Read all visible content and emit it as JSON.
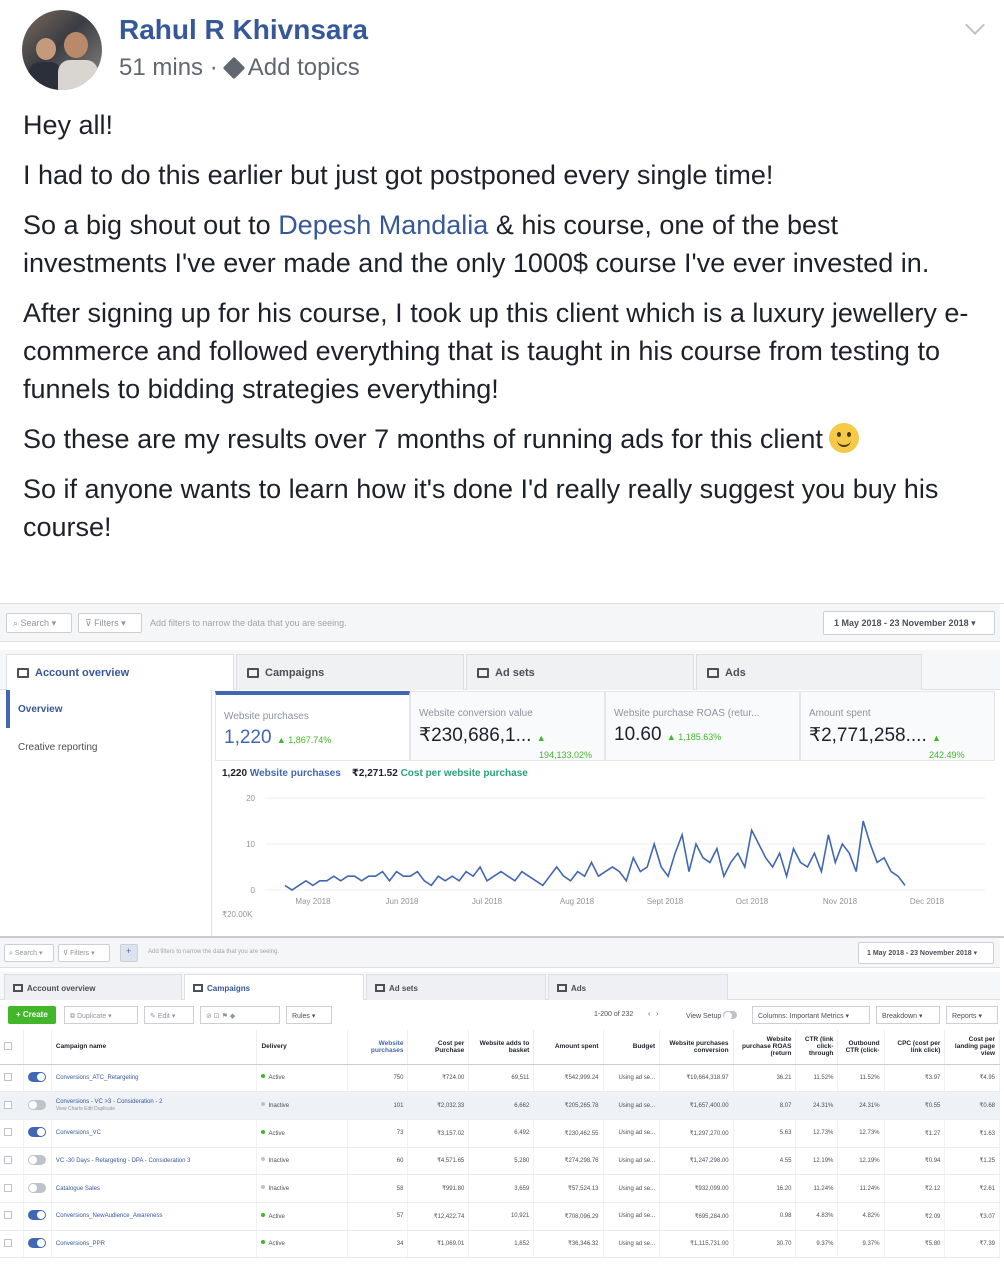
{
  "post": {
    "author": "Rahul R Khivnsara",
    "time": "51 mins",
    "separator": "·",
    "add_topics": "Add topics",
    "p1": "Hey all!",
    "p2": "I had to do this earlier but just got postponed every single time!",
    "p3_before": "So a big shout out to ",
    "p3_mention": "Depesh Mandalia",
    "p3_after": " & his course, one of the best investments I've ever made and the only 1000$ course I've ever invested in.",
    "p4": "After signing up for his course, I took up this client which is a luxury jewellery e-commerce and followed everything that is taught in his course from testing to funnels to bidding strategies everything!",
    "p5": "So these are my results over 7 months of running ads for this client",
    "p6": "So if anyone wants to learn how it's done I'd really really suggest you buy his course!"
  },
  "shot1": {
    "search": "Search",
    "filters": "Filters",
    "hint": "Add filters to narrow the data that you are seeing.",
    "date": "1 May 2018 - 23 November 2018",
    "tabs": [
      "Account overview",
      "Campaigns",
      "Ad sets",
      "Ads"
    ],
    "nav": [
      "Overview",
      "Creative reporting"
    ],
    "metrics": [
      {
        "label": "Website purchases",
        "value": "1,220",
        "delta": "1,867.74%"
      },
      {
        "label": "Website conversion value",
        "value": "₹230,686,1...",
        "delta": "194,133.02%"
      },
      {
        "label": "Website purchase ROAS (retur...",
        "value": "10.60",
        "delta": "1,185.63%"
      },
      {
        "label": "Amount spent",
        "value": "₹2,771,258....",
        "delta": "242.49%"
      }
    ],
    "summary_count": "1,220",
    "summary_label": "Website purchases",
    "summary_cost": "₹2,271.52",
    "summary_cost_label": "Cost per website purchase",
    "bottom_axis_label": "₹20.00K"
  },
  "chart_data": {
    "type": "line",
    "y_ticks": [
      "20",
      "10",
      "0"
    ],
    "ylim": [
      0,
      20
    ],
    "x_labels": [
      "May 2018",
      "Jun 2018",
      "Jul 2018",
      "Aug 2018",
      "Sept 2018",
      "Oct 2018",
      "Nov 2018",
      "Dec 2018"
    ],
    "series": [
      {
        "values": [
          1,
          0,
          1,
          2,
          1,
          2,
          2,
          3,
          2,
          3,
          3,
          2,
          3,
          3,
          4,
          2,
          4,
          3,
          3,
          4,
          2,
          1,
          3,
          2,
          3,
          2,
          4,
          3,
          5,
          2,
          3,
          4,
          3,
          2,
          4,
          3,
          2,
          1,
          3,
          5,
          3,
          2,
          4,
          3,
          6,
          3,
          4,
          5,
          4,
          2,
          7,
          4,
          5,
          10,
          5,
          3,
          8,
          12,
          4,
          10,
          7,
          6,
          9,
          3,
          6,
          8,
          5,
          13,
          10,
          7,
          5,
          8,
          3,
          9,
          6,
          5,
          8,
          4,
          12,
          6,
          10,
          8,
          4,
          15,
          10,
          6,
          7,
          4,
          3,
          1
        ]
      }
    ]
  },
  "shot2": {
    "search": "Search",
    "filters": "Filters",
    "hint": "Add filters to narrow the data that you are seeing.",
    "date": "1 May 2018 - 23 November 2018",
    "tabs": [
      "Account overview",
      "Campaigns",
      "Ad sets",
      "Ads"
    ],
    "create": "+ Create",
    "duplicate": "Duplicate",
    "edit": "Edit",
    "rules": "Rules",
    "pager": "1-200 of 232",
    "view_setup": "View Setup",
    "columns": "Columns: Important Metrics",
    "breakdown": "Breakdown",
    "reports": "Reports",
    "headers": [
      "Campaign name",
      "Delivery",
      "Website purchases",
      "Cost per Purchase",
      "Website adds to basket",
      "Amount spent",
      "Budget",
      "Website purchases conversion",
      "Website purchase ROAS (return",
      "CTR (link click-through",
      "Outbound CTR (click-",
      "CPC (cost per link click)",
      "Cost per landing page view"
    ],
    "rows": [
      {
        "name": "Conversions_ATC_Retargeting",
        "sub": "",
        "on": true,
        "delivery": "Active",
        "purchases": "750",
        "cpp": "₹724.00",
        "atb": "69,511",
        "spent": "₹542,999.24",
        "budget": "Using ad se...",
        "conv": "₹19,664,318.97",
        "roas": "36.21",
        "ctr": "11.52%",
        "octr": "11.52%",
        "cpc": "₹3.97",
        "cplp": "₹4.95"
      },
      {
        "name": "Conversions - VC >3 - Consideration - 2",
        "sub": "View Charts  Edit  Duplicate",
        "on": false,
        "delivery": "Inactive",
        "purchases": "101",
        "cpp": "₹2,032.33",
        "atb": "6,662",
        "spent": "₹205,265.78",
        "budget": "Using ad se...",
        "conv": "₹1,657,400.00",
        "roas": "8.07",
        "ctr": "24.31%",
        "octr": "24.31%",
        "cpc": "₹0.55",
        "cplp": "₹0.68"
      },
      {
        "name": "Conversions_VC",
        "sub": "",
        "on": true,
        "delivery": "Active",
        "purchases": "73",
        "cpp": "₹3,157.02",
        "atb": "6,492",
        "spent": "₹230,462.55",
        "budget": "Using ad se...",
        "conv": "₹1,297,270.00",
        "roas": "5.63",
        "ctr": "12.73%",
        "octr": "12.73%",
        "cpc": "₹1.27",
        "cplp": "₹1.63"
      },
      {
        "name": "VC -30 Days - Retargeting - DPA - Consideration 3",
        "sub": "",
        "on": false,
        "delivery": "Inactive",
        "purchases": "60",
        "cpp": "₹4,571.65",
        "atb": "5,280",
        "spent": "₹274,298.76",
        "budget": "Using ad se...",
        "conv": "₹1,247,298.00",
        "roas": "4.55",
        "ctr": "12.19%",
        "octr": "12.19%",
        "cpc": "₹0.94",
        "cplp": "₹1.25"
      },
      {
        "name": "Catalogue Sales",
        "sub": "",
        "on": false,
        "delivery": "Inactive",
        "purchases": "58",
        "cpp": "₹991.80",
        "atb": "3,659",
        "spent": "₹57,524.13",
        "budget": "Using ad se...",
        "conv": "₹932,099.00",
        "roas": "16.20",
        "ctr": "11.24%",
        "octr": "11.24%",
        "cpc": "₹2.12",
        "cplp": "₹2.61"
      },
      {
        "name": "Conversions_NewAudience_Awareness",
        "sub": "",
        "on": true,
        "delivery": "Active",
        "purchases": "57",
        "cpp": "₹12,422.74",
        "atb": "10,921",
        "spent": "₹708,096.29",
        "budget": "Using ad se...",
        "conv": "₹695,284.00",
        "roas": "0.98",
        "ctr": "4.83%",
        "octr": "4.82%",
        "cpc": "₹2.09",
        "cplp": "₹3.07"
      },
      {
        "name": "Conversions_PPR",
        "sub": "",
        "on": true,
        "delivery": "Active",
        "purchases": "34",
        "cpp": "₹1,069.01",
        "atb": "1,852",
        "spent": "₹36,346.32",
        "budget": "Using ad se...",
        "conv": "₹1,115,731.00",
        "roas": "30.70",
        "ctr": "9.37%",
        "octr": "9.37%",
        "cpc": "₹5.80",
        "cplp": "₹7.39"
      }
    ]
  }
}
